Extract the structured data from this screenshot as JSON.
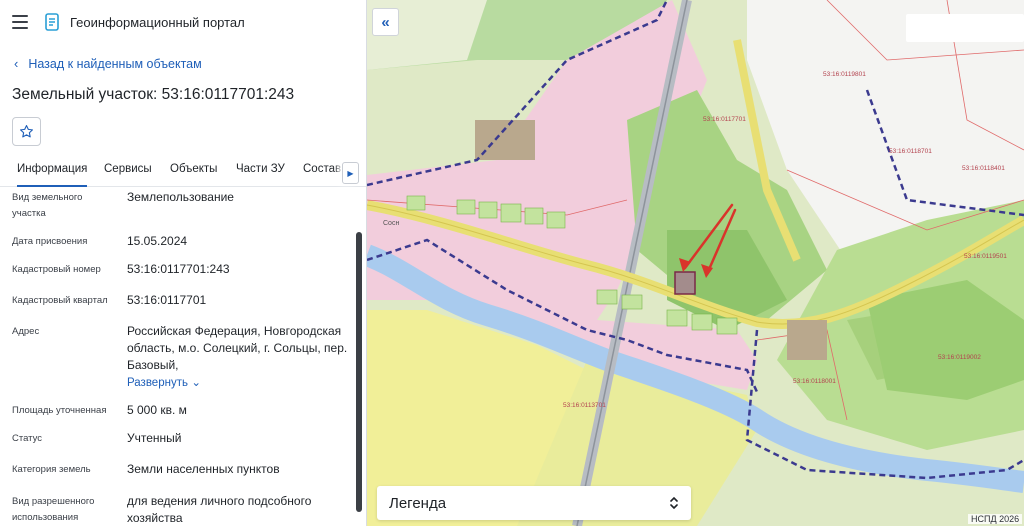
{
  "app": {
    "title": "Геоинформационный портал"
  },
  "nav": {
    "back_label": "Назад к найденным объектам"
  },
  "object": {
    "title": "Земельный участок: 53:16:0117701:243"
  },
  "tabs": [
    {
      "label": "Информация",
      "active": true
    },
    {
      "label": "Сервисы"
    },
    {
      "label": "Объекты"
    },
    {
      "label": "Части ЗУ"
    },
    {
      "label": "Состав"
    }
  ],
  "fields": [
    {
      "label": "Вид земельного участка",
      "value": "Землепользование"
    },
    {
      "label": "Дата присвоения",
      "value": "15.05.2024"
    },
    {
      "label": "Кадастровый номер",
      "value": "53:16:0117701:243"
    },
    {
      "label": "Кадастровый квартал",
      "value": "53:16:0117701"
    },
    {
      "label": "Адрес",
      "value": "Российская Федерация, Новгородская область, м.о. Солецкий, г. Сольцы, пер. Базовый,",
      "expand": "Развернуть"
    },
    {
      "label": "Площадь уточненная",
      "value": "5 000 кв. м"
    },
    {
      "label": "Статус",
      "value": "Учтенный"
    },
    {
      "label": "Категория земель",
      "value": "Земли населенных пунктов"
    },
    {
      "label": "Вид разрешенного использования",
      "value": "для ведения личного подсобного хозяйства"
    }
  ],
  "map": {
    "legend_label": "Легенда",
    "copyright": "НСПД 2026",
    "labels": [
      "53:16:0119801",
      "53:16:0118701",
      "53:16:0118401",
      "53:16:0117701",
      "53:16:0119501",
      "53:16:0118001",
      "53:16:0119002",
      "53:16:0113701",
      "Сосн"
    ]
  },
  "colors": {
    "accent": "#1f5fb8",
    "arrow": "#d9342b",
    "boundary": "#3b3a8f"
  }
}
